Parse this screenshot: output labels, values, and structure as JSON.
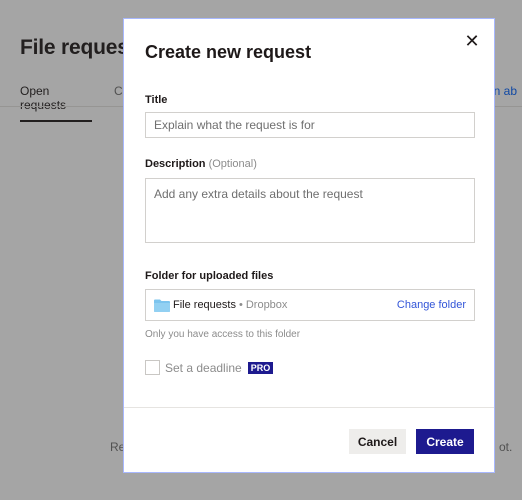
{
  "background": {
    "title": "File reques",
    "tabs": [
      "Open requests",
      "C"
    ],
    "learn_link": "arn ab",
    "bottom_left": "Re",
    "bottom_right": "ot."
  },
  "modal": {
    "title": "Create new request",
    "close_icon": "close-icon",
    "title_label": "Title",
    "title_placeholder": "Explain what the request is for",
    "description_label": "Description",
    "description_optional": "(Optional)",
    "description_placeholder": "Add any extra details about the request",
    "folder_label": "Folder for uploaded files",
    "folder_name": "File requests",
    "folder_separator": "•",
    "folder_location": "Dropbox",
    "change_folder": "Change folder",
    "access_hint": "Only you have access to this folder",
    "deadline_label": "Set a deadline",
    "pro_badge": "PRO",
    "cancel_label": "Cancel",
    "create_label": "Create"
  },
  "colors": {
    "accent": "#1d1a8f",
    "link": "#3255d8",
    "folder": "#7cc4ee"
  }
}
